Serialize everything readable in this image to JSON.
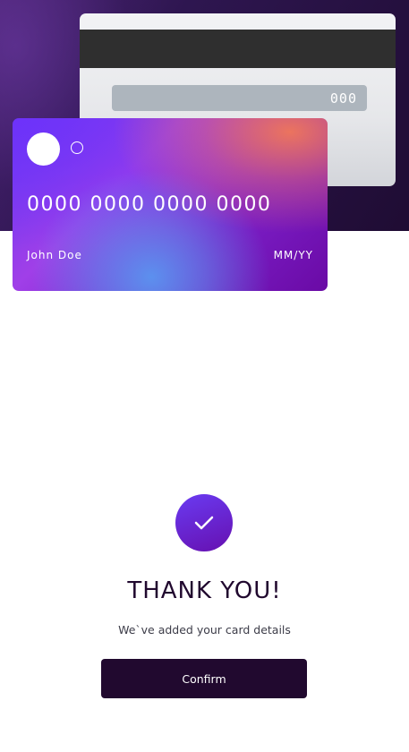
{
  "card_back": {
    "cvc": "000"
  },
  "card_front": {
    "number": "0000 0000 0000 0000",
    "cardholder_name": "John Doe",
    "expiry": "MM/YY"
  },
  "success": {
    "icon": "check-icon",
    "title": "THANK YOU!",
    "message": "We`ve added your card details",
    "button_label": "Confirm"
  },
  "colors": {
    "dark_violet": "#21092f",
    "accent_gradient_start": "#6a3bf2",
    "accent_gradient_end": "#6610b0"
  }
}
